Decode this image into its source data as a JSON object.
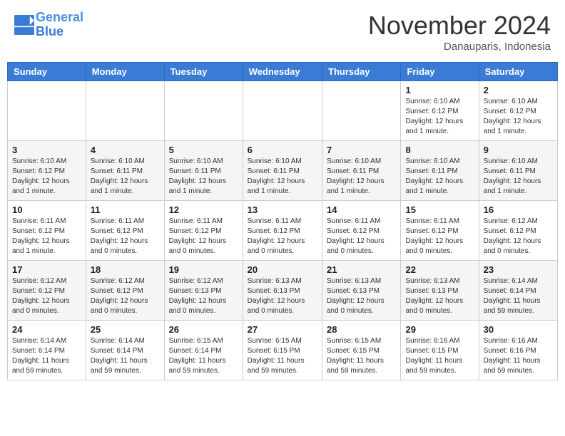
{
  "logo": {
    "line1": "General",
    "line2": "Blue"
  },
  "title": "November 2024",
  "location": "Danauparis, Indonesia",
  "days_of_week": [
    "Sunday",
    "Monday",
    "Tuesday",
    "Wednesday",
    "Thursday",
    "Friday",
    "Saturday"
  ],
  "weeks": [
    [
      {
        "day": "",
        "info": ""
      },
      {
        "day": "",
        "info": ""
      },
      {
        "day": "",
        "info": ""
      },
      {
        "day": "",
        "info": ""
      },
      {
        "day": "",
        "info": ""
      },
      {
        "day": "1",
        "info": "Sunrise: 6:10 AM\nSunset: 6:12 PM\nDaylight: 12 hours and 1 minute."
      },
      {
        "day": "2",
        "info": "Sunrise: 6:10 AM\nSunset: 6:12 PM\nDaylight: 12 hours and 1 minute."
      }
    ],
    [
      {
        "day": "3",
        "info": "Sunrise: 6:10 AM\nSunset: 6:12 PM\nDaylight: 12 hours and 1 minute."
      },
      {
        "day": "4",
        "info": "Sunrise: 6:10 AM\nSunset: 6:11 PM\nDaylight: 12 hours and 1 minute."
      },
      {
        "day": "5",
        "info": "Sunrise: 6:10 AM\nSunset: 6:11 PM\nDaylight: 12 hours and 1 minute."
      },
      {
        "day": "6",
        "info": "Sunrise: 6:10 AM\nSunset: 6:11 PM\nDaylight: 12 hours and 1 minute."
      },
      {
        "day": "7",
        "info": "Sunrise: 6:10 AM\nSunset: 6:11 PM\nDaylight: 12 hours and 1 minute."
      },
      {
        "day": "8",
        "info": "Sunrise: 6:10 AM\nSunset: 6:11 PM\nDaylight: 12 hours and 1 minute."
      },
      {
        "day": "9",
        "info": "Sunrise: 6:10 AM\nSunset: 6:11 PM\nDaylight: 12 hours and 1 minute."
      }
    ],
    [
      {
        "day": "10",
        "info": "Sunrise: 6:11 AM\nSunset: 6:12 PM\nDaylight: 12 hours and 1 minute."
      },
      {
        "day": "11",
        "info": "Sunrise: 6:11 AM\nSunset: 6:12 PM\nDaylight: 12 hours and 0 minutes."
      },
      {
        "day": "12",
        "info": "Sunrise: 6:11 AM\nSunset: 6:12 PM\nDaylight: 12 hours and 0 minutes."
      },
      {
        "day": "13",
        "info": "Sunrise: 6:11 AM\nSunset: 6:12 PM\nDaylight: 12 hours and 0 minutes."
      },
      {
        "day": "14",
        "info": "Sunrise: 6:11 AM\nSunset: 6:12 PM\nDaylight: 12 hours and 0 minutes."
      },
      {
        "day": "15",
        "info": "Sunrise: 6:11 AM\nSunset: 6:12 PM\nDaylight: 12 hours and 0 minutes."
      },
      {
        "day": "16",
        "info": "Sunrise: 6:12 AM\nSunset: 6:12 PM\nDaylight: 12 hours and 0 minutes."
      }
    ],
    [
      {
        "day": "17",
        "info": "Sunrise: 6:12 AM\nSunset: 6:12 PM\nDaylight: 12 hours and 0 minutes."
      },
      {
        "day": "18",
        "info": "Sunrise: 6:12 AM\nSunset: 6:12 PM\nDaylight: 12 hours and 0 minutes."
      },
      {
        "day": "19",
        "info": "Sunrise: 6:12 AM\nSunset: 6:13 PM\nDaylight: 12 hours and 0 minutes."
      },
      {
        "day": "20",
        "info": "Sunrise: 6:13 AM\nSunset: 6:13 PM\nDaylight: 12 hours and 0 minutes."
      },
      {
        "day": "21",
        "info": "Sunrise: 6:13 AM\nSunset: 6:13 PM\nDaylight: 12 hours and 0 minutes."
      },
      {
        "day": "22",
        "info": "Sunrise: 6:13 AM\nSunset: 6:13 PM\nDaylight: 12 hours and 0 minutes."
      },
      {
        "day": "23",
        "info": "Sunrise: 6:14 AM\nSunset: 6:14 PM\nDaylight: 11 hours and 59 minutes."
      }
    ],
    [
      {
        "day": "24",
        "info": "Sunrise: 6:14 AM\nSunset: 6:14 PM\nDaylight: 11 hours and 59 minutes."
      },
      {
        "day": "25",
        "info": "Sunrise: 6:14 AM\nSunset: 6:14 PM\nDaylight: 11 hours and 59 minutes."
      },
      {
        "day": "26",
        "info": "Sunrise: 6:15 AM\nSunset: 6:14 PM\nDaylight: 11 hours and 59 minutes."
      },
      {
        "day": "27",
        "info": "Sunrise: 6:15 AM\nSunset: 6:15 PM\nDaylight: 11 hours and 59 minutes."
      },
      {
        "day": "28",
        "info": "Sunrise: 6:15 AM\nSunset: 6:15 PM\nDaylight: 11 hours and 59 minutes."
      },
      {
        "day": "29",
        "info": "Sunrise: 6:16 AM\nSunset: 6:15 PM\nDaylight: 11 hours and 59 minutes."
      },
      {
        "day": "30",
        "info": "Sunrise: 6:16 AM\nSunset: 6:16 PM\nDaylight: 11 hours and 59 minutes."
      }
    ]
  ]
}
